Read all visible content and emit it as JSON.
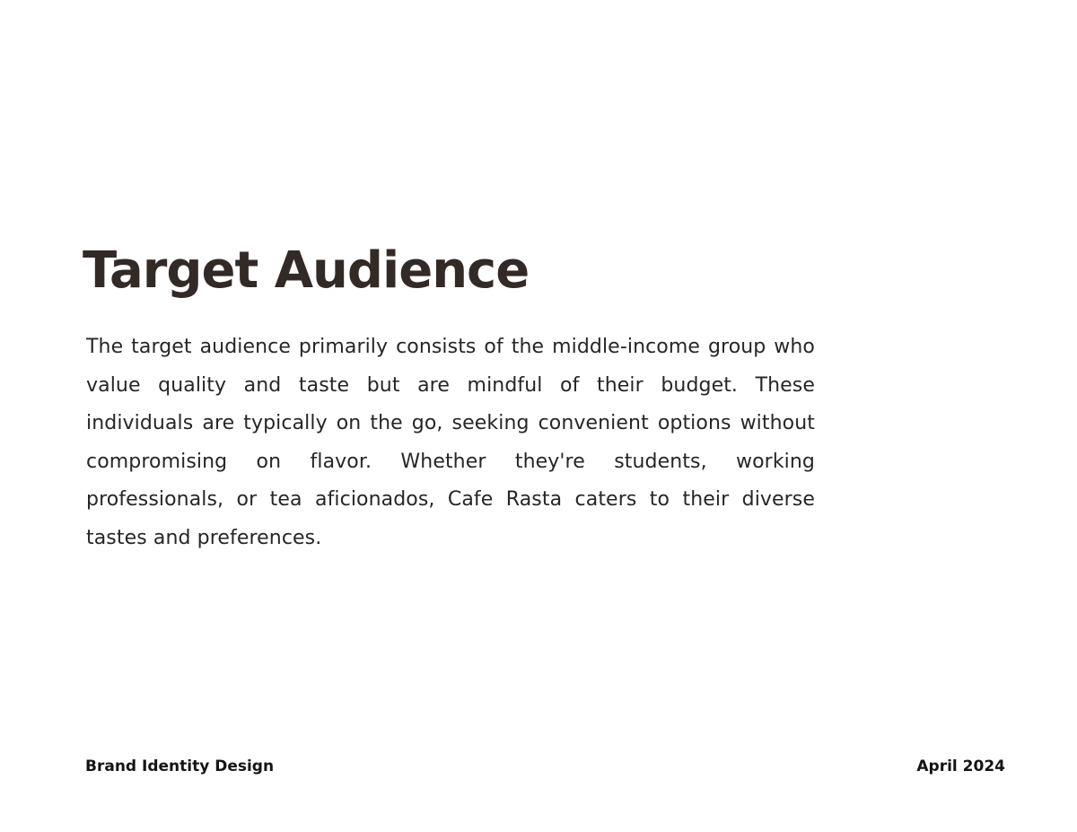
{
  "slide": {
    "title": "Target Audience",
    "body": "The target audience primarily consists of the middle-income group who value quality and taste but are mindful of their budget. These individuals are typically on the go, seeking convenient options without compromising on flavor. Whether they're students, working professionals, or tea aficionados, Cafe Rasta caters to their diverse tastes and preferences.",
    "title_color": "#322a27",
    "text_color": "#262626"
  },
  "footer": {
    "left": "Brand Identity Design",
    "right": "April 2024"
  }
}
